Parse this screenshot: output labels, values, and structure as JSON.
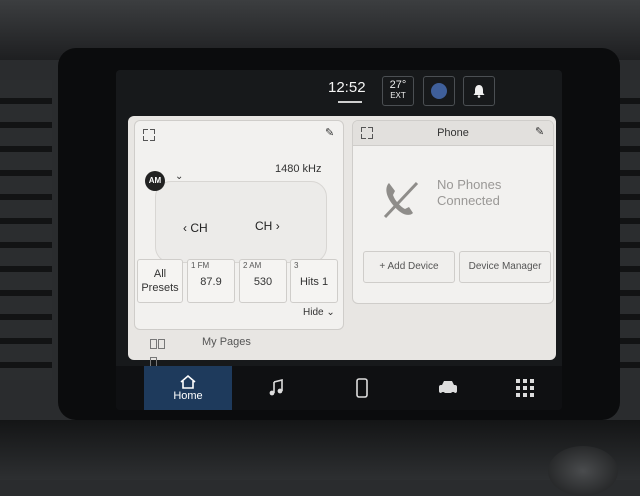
{
  "status": {
    "clock": "12:52",
    "temperature": "27°",
    "temp_label": "EXT"
  },
  "radio": {
    "band": "AM",
    "frequency": "1480 kHz",
    "ch_prev": "CH",
    "ch_next": "CH",
    "all_presets": [
      "All",
      "Presets"
    ],
    "presets": [
      {
        "num": "1 FM",
        "value": "87.9"
      },
      {
        "num": "2 AM",
        "value": "530"
      },
      {
        "num": "3",
        "value": "Hits 1"
      }
    ],
    "hide_label": "Hide"
  },
  "phone": {
    "title": "Phone",
    "no_phones": [
      "No Phones",
      "Connected"
    ],
    "add_device": "+ Add Device",
    "device_manager": "Device Manager"
  },
  "my_pages": "My Pages",
  "nav": {
    "home": "Home"
  }
}
